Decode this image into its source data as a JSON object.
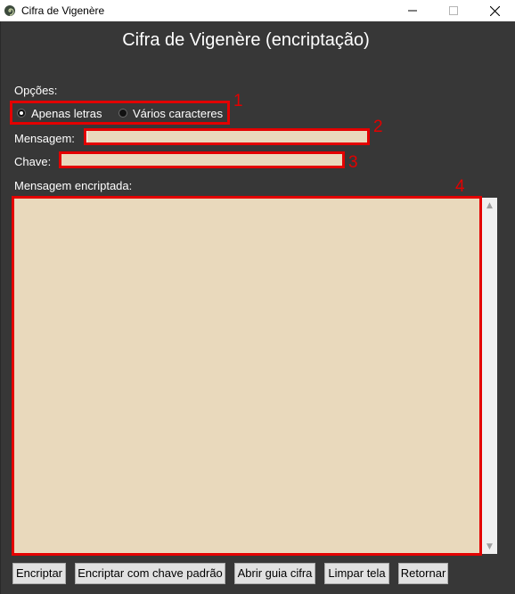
{
  "window": {
    "title": "Cifra de Vigenère",
    "controls": [
      "minimize-icon",
      "maximize-icon",
      "close-icon"
    ]
  },
  "header": {
    "title": "Cifra de Vigenère (encriptação)"
  },
  "options": {
    "label": "Opções:",
    "radios": [
      {
        "label": "Apenas letras",
        "checked": true
      },
      {
        "label": "Vários caracteres",
        "checked": false
      }
    ]
  },
  "fields": {
    "message_label": "Mensagem:",
    "message_value": "",
    "key_label": "Chave:",
    "key_value": ""
  },
  "output": {
    "label": "Mensagem encriptada:",
    "value": ""
  },
  "annotations": [
    "1",
    "2",
    "3",
    "4"
  ],
  "buttons": {
    "encrypt": "Encriptar",
    "encrypt_default": "Encriptar com chave padrão",
    "open_guide": "Abrir guia cifra",
    "clear": "Limpar tela",
    "back": "Retornar"
  },
  "colors": {
    "background": "#373737",
    "field": "#e9d9bc",
    "highlight": "#e30000"
  }
}
